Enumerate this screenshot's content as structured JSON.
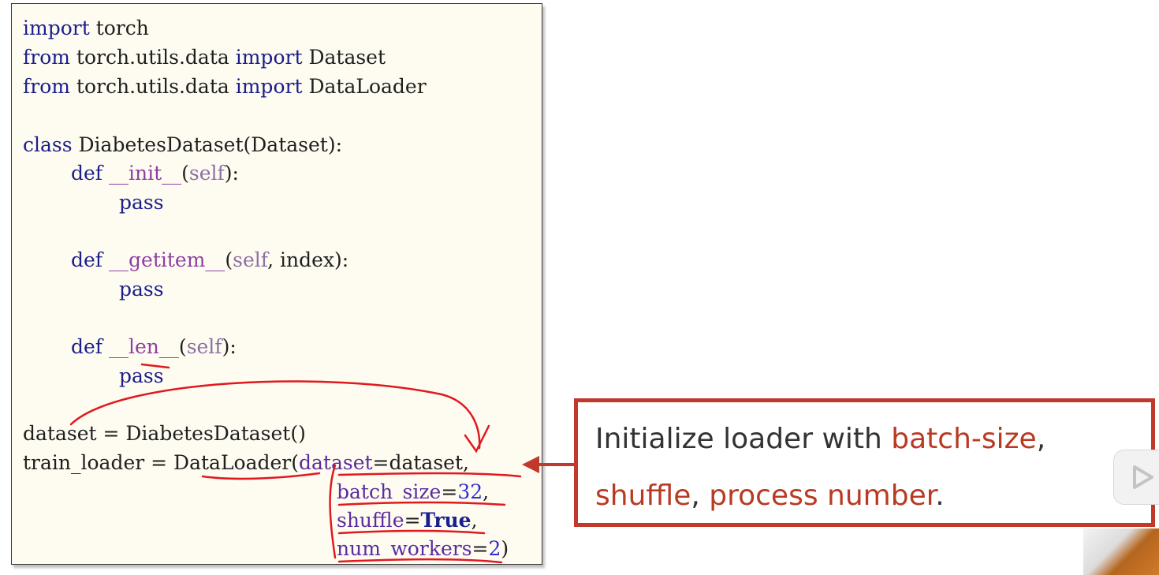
{
  "code": {
    "line1": {
      "kw": "import",
      "rest": " torch"
    },
    "line2": {
      "kw1": "from",
      "mod": " torch.utils.data ",
      "kw2": "import",
      "name": " Dataset"
    },
    "line3": {
      "kw1": "from",
      "mod": " torch.utils.data ",
      "kw2": "import",
      "name": " DataLoader"
    },
    "line4": {
      "kw": "class",
      "rest": " DiabetesDataset(Dataset):"
    },
    "line5": {
      "kw": "def",
      "magic": "__init__",
      "open": "(",
      "self": "self",
      "close": "):"
    },
    "line6": {
      "kw": "pass"
    },
    "line7": {
      "kw": "def",
      "magic": "__getitem__",
      "open": "(",
      "self": "self",
      "rest": ", index):"
    },
    "line8": {
      "kw": "pass"
    },
    "line9": {
      "kw": "def",
      "magic": "__len__",
      "open": "(",
      "self": "self",
      "close": "):"
    },
    "line10": {
      "kw": "pass"
    },
    "line11": {
      "text": "dataset = DiabetesDataset()"
    },
    "line12": {
      "pre": "train_loader = DataLoader(",
      "arg": "dataset",
      "eq": "=dataset,"
    },
    "line13": {
      "arg": "batch_size",
      "eq": "=",
      "num": "32",
      "tail": ","
    },
    "line14": {
      "arg": "shuffle",
      "eq": "=",
      "val": "True",
      "tail": ","
    },
    "line15": {
      "arg": "num_workers",
      "eq": "=",
      "num": "2",
      "tail": ")"
    }
  },
  "callout": {
    "line1_plain": "Initialize loader with ",
    "line1_hl": "batch-size",
    "line1_end": ",",
    "line2_hl1": "shuffle",
    "line2_plain": ", ",
    "line2_hl2": "process number",
    "line2_end": "."
  },
  "colors": {
    "keyword": "#1a1f8c",
    "annotation_red": "#e0191f",
    "callout_border": "#c0392b",
    "highlight": "#b93a23"
  },
  "icons": {
    "play": "play-icon",
    "arrow": "arrow-left-icon"
  }
}
